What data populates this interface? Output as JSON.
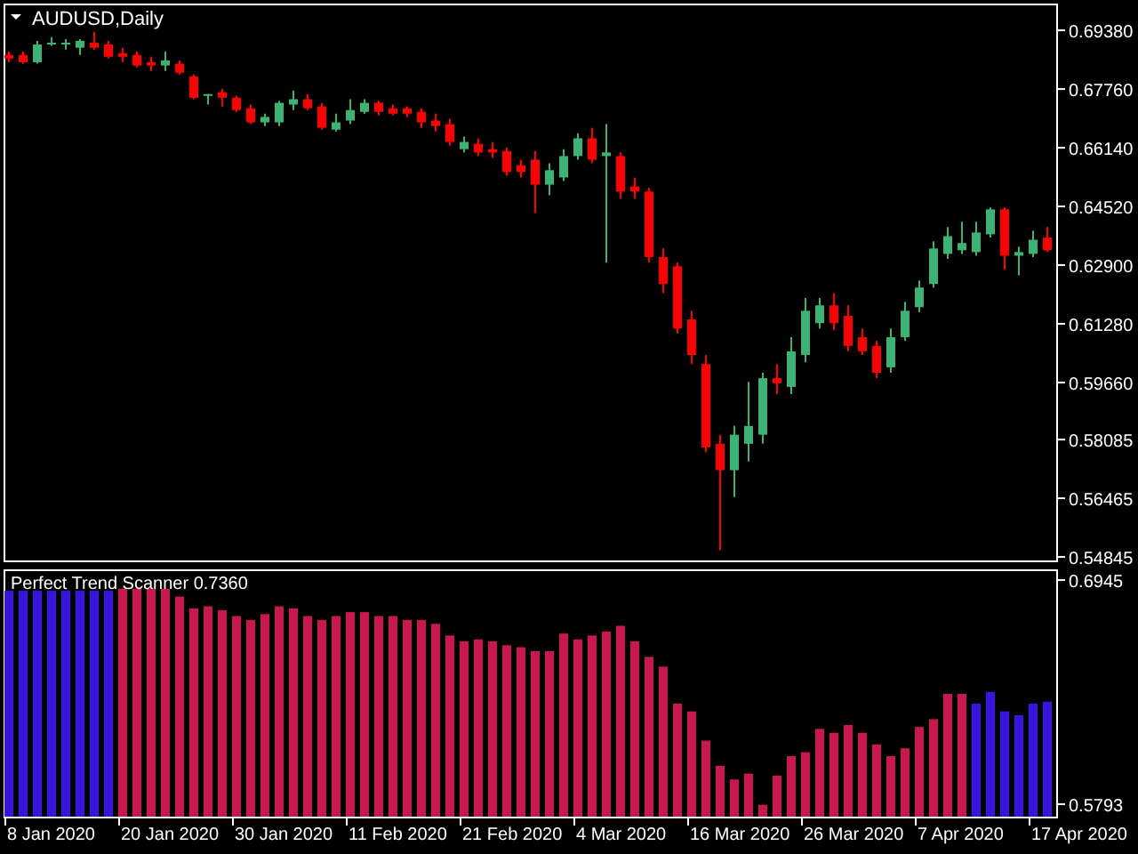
{
  "price_chart": {
    "title": "AUDUSD,Daily",
    "chart_data": {
      "type": "candlestick",
      "ylim": [
        0.547,
        0.7007
      ],
      "yticks": [
        {
          "value": 0.6938,
          "label": "0.69380"
        },
        {
          "value": 0.6776,
          "label": "0.67760"
        },
        {
          "value": 0.6614,
          "label": "0.66140"
        },
        {
          "value": 0.6452,
          "label": "0.64520"
        },
        {
          "value": 0.629,
          "label": "0.62900"
        },
        {
          "value": 0.6128,
          "label": "0.61280"
        },
        {
          "value": 0.5966,
          "label": "0.59660"
        },
        {
          "value": 0.58085,
          "label": "0.58085"
        },
        {
          "value": 0.56465,
          "label": "0.56465"
        },
        {
          "value": 0.54845,
          "label": "0.54845"
        }
      ],
      "categories": [
        null,
        null,
        null,
        null,
        null,
        null,
        null,
        null,
        null,
        null,
        null,
        null,
        null,
        null,
        null,
        null,
        null,
        null,
        null,
        null,
        null,
        null,
        null,
        null,
        null,
        null,
        null,
        null,
        null,
        null,
        null,
        null,
        null,
        null,
        null,
        null,
        null,
        null,
        null,
        null,
        null,
        null,
        null,
        null,
        null,
        null,
        null,
        null,
        null,
        null,
        null,
        null,
        null,
        null,
        null,
        null,
        null,
        null,
        null,
        null,
        null,
        null,
        null,
        null,
        null,
        null,
        null,
        null,
        null,
        null,
        null,
        null,
        null,
        null
      ],
      "ohlc": [
        [
          0.687,
          0.688,
          0.685,
          0.686
        ],
        [
          0.687,
          0.688,
          0.6846,
          0.685
        ],
        [
          0.685,
          0.6909,
          0.6846,
          0.6899
        ],
        [
          0.6899,
          0.6919,
          0.6895,
          0.6904
        ],
        [
          0.6899,
          0.6914,
          0.6885,
          0.6904
        ],
        [
          0.689,
          0.6914,
          0.687,
          0.6909
        ],
        [
          0.6904,
          0.6934,
          0.6885,
          0.689
        ],
        [
          0.6899,
          0.6909,
          0.686,
          0.6865
        ],
        [
          0.6875,
          0.689,
          0.685,
          0.6865
        ],
        [
          0.687,
          0.688,
          0.6836,
          0.6841
        ],
        [
          0.685,
          0.6865,
          0.6826,
          0.6841
        ],
        [
          0.6841,
          0.688,
          0.6826,
          0.6855
        ],
        [
          0.6846,
          0.6855,
          0.6816,
          0.6821
        ],
        [
          0.6811,
          0.6816,
          0.6748,
          0.6752
        ],
        [
          0.6757,
          0.6762,
          0.6733,
          0.6762
        ],
        [
          0.6767,
          0.6777,
          0.6728,
          0.6752
        ],
        [
          0.6752,
          0.6757,
          0.6713,
          0.6718
        ],
        [
          0.6723,
          0.6733,
          0.6679,
          0.6684
        ],
        [
          0.6684,
          0.6708,
          0.6674,
          0.6699
        ],
        [
          0.6684,
          0.6743,
          0.6674,
          0.6738
        ],
        [
          0.6733,
          0.6772,
          0.6718,
          0.6748
        ],
        [
          0.6748,
          0.6762,
          0.6718,
          0.6723
        ],
        [
          0.6728,
          0.6738,
          0.6664,
          0.6669
        ],
        [
          0.6664,
          0.6708,
          0.6659,
          0.6684
        ],
        [
          0.6689,
          0.6748,
          0.6679,
          0.6718
        ],
        [
          0.6713,
          0.6748,
          0.6708,
          0.6738
        ],
        [
          0.6738,
          0.6743,
          0.6703,
          0.6713
        ],
        [
          0.6723,
          0.6733,
          0.6703,
          0.6708
        ],
        [
          0.6723,
          0.6728,
          0.6699,
          0.6708
        ],
        [
          0.6713,
          0.6723,
          0.6669,
          0.6684
        ],
        [
          0.6689,
          0.6708,
          0.6659,
          0.6674
        ],
        [
          0.6679,
          0.6694,
          0.662,
          0.663
        ],
        [
          0.661,
          0.6645,
          0.6601,
          0.663
        ],
        [
          0.6625,
          0.664,
          0.6591,
          0.6601
        ],
        [
          0.661,
          0.663,
          0.6586,
          0.6601
        ],
        [
          0.6605,
          0.6615,
          0.6537,
          0.6547
        ],
        [
          0.6566,
          0.6581,
          0.6532,
          0.6547
        ],
        [
          0.6581,
          0.6605,
          0.6434,
          0.6512
        ],
        [
          0.6512,
          0.6571,
          0.6483,
          0.6552
        ],
        [
          0.6532,
          0.661,
          0.6522,
          0.6591
        ],
        [
          0.6591,
          0.6654,
          0.6581,
          0.664
        ],
        [
          0.664,
          0.6669,
          0.6571,
          0.6581
        ],
        [
          0.6591,
          0.6679,
          0.6297,
          0.6601
        ],
        [
          0.6591,
          0.6601,
          0.6473,
          0.6493
        ],
        [
          0.6507,
          0.6532,
          0.6473,
          0.6493
        ],
        [
          0.6493,
          0.6503,
          0.6297,
          0.6312
        ],
        [
          0.6312,
          0.6336,
          0.6213,
          0.6238
        ],
        [
          0.6287,
          0.6297,
          0.6101,
          0.6115
        ],
        [
          0.614,
          0.6164,
          0.6017,
          0.6042
        ],
        [
          0.6017,
          0.6042,
          0.5773,
          0.5787
        ],
        [
          0.5797,
          0.5822,
          0.5503,
          0.5724
        ],
        [
          0.5724,
          0.5846,
          0.565,
          0.5822
        ],
        [
          0.5797,
          0.5968,
          0.5748,
          0.5846
        ],
        [
          0.5822,
          0.5993,
          0.5797,
          0.5978
        ],
        [
          0.5978,
          0.6017,
          0.5934,
          0.5964
        ],
        [
          0.5954,
          0.6091,
          0.5934,
          0.6052
        ],
        [
          0.6042,
          0.6199,
          0.6022,
          0.6164
        ],
        [
          0.613,
          0.6199,
          0.6115,
          0.6179
        ],
        [
          0.6179,
          0.6213,
          0.611,
          0.613
        ],
        [
          0.615,
          0.6179,
          0.6052,
          0.6067
        ],
        [
          0.6091,
          0.6115,
          0.6042,
          0.6052
        ],
        [
          0.6067,
          0.6081,
          0.5978,
          0.5993
        ],
        [
          0.6008,
          0.6115,
          0.5993,
          0.6091
        ],
        [
          0.6091,
          0.6189,
          0.6081,
          0.6164
        ],
        [
          0.6174,
          0.6248,
          0.616,
          0.6228
        ],
        [
          0.6238,
          0.6356,
          0.6228,
          0.6336
        ],
        [
          0.6321,
          0.6395,
          0.6307,
          0.637
        ],
        [
          0.6331,
          0.641,
          0.6321,
          0.6351
        ],
        [
          0.6326,
          0.641,
          0.6316,
          0.638
        ],
        [
          0.6375,
          0.6449,
          0.6366,
          0.6444
        ],
        [
          0.6444,
          0.6449,
          0.6277,
          0.6316
        ],
        [
          0.6316,
          0.6341,
          0.6262,
          0.6326
        ],
        [
          0.6321,
          0.6385,
          0.6312,
          0.636
        ],
        [
          0.6366,
          0.6395,
          0.6326,
          0.6331
        ]
      ]
    }
  },
  "indicator": {
    "chart_data": {
      "type": "bar",
      "title": "Perfect Trend Scanner 0.7360",
      "ylim": [
        0.5729,
        0.6991
      ],
      "yticks": [
        {
          "value": 0.6945,
          "label": "0.6945"
        },
        {
          "value": 0.5793,
          "label": "0.5793"
        }
      ],
      "categories": [
        null,
        null,
        null,
        null,
        null,
        null,
        null,
        null,
        null,
        null,
        null,
        null,
        null,
        null,
        null,
        null,
        null,
        null,
        null,
        null,
        null,
        null,
        null,
        null,
        null,
        null,
        null,
        null,
        null,
        null,
        null,
        null,
        null,
        null,
        null,
        null,
        null,
        null,
        null,
        null,
        null,
        null,
        null,
        null,
        null,
        null,
        null,
        null,
        null,
        null,
        null,
        null,
        null,
        null,
        null,
        null,
        null,
        null,
        null,
        null,
        null,
        null,
        null,
        null,
        null,
        null,
        null,
        null,
        null,
        null,
        null,
        null,
        null,
        null
      ],
      "series": [
        {
          "color": "#3c14e0",
          "values": [
            0.689,
            0.689,
            0.689,
            0.689,
            0.689,
            0.689,
            0.689,
            0.689,
            null,
            null,
            null,
            null,
            null,
            null,
            null,
            null,
            null,
            null,
            null,
            null,
            null,
            null,
            null,
            null,
            null,
            null,
            null,
            null,
            null,
            null,
            null,
            null,
            null,
            null,
            null,
            null,
            null,
            null,
            null,
            null,
            null,
            null,
            null,
            null,
            null,
            null,
            null,
            null,
            null,
            null,
            null,
            null,
            null,
            null,
            null,
            null,
            null,
            null,
            null,
            null,
            null,
            null,
            null,
            null,
            null,
            null,
            null,
            null,
            0.631,
            0.637,
            0.627,
            0.625,
            0.631,
            0.632
          ]
        },
        {
          "color": "#c8184f",
          "values": [
            null,
            null,
            null,
            null,
            null,
            null,
            null,
            null,
            0.69,
            0.69,
            0.69,
            0.69,
            0.686,
            0.68,
            0.681,
            0.679,
            0.676,
            0.674,
            0.677,
            0.681,
            0.68,
            0.676,
            0.674,
            0.676,
            0.678,
            0.678,
            0.676,
            0.676,
            0.674,
            0.674,
            0.672,
            0.666,
            0.663,
            0.664,
            0.663,
            0.661,
            0.66,
            0.658,
            0.658,
            0.667,
            0.664,
            0.666,
            0.668,
            0.671,
            0.663,
            0.655,
            0.65,
            0.631,
            0.627,
            0.612,
            0.599,
            0.592,
            0.595,
            0.579,
            0.594,
            0.604,
            0.606,
            0.618,
            0.616,
            0.62,
            0.616,
            0.61,
            0.604,
            0.608,
            0.619,
            0.623,
            0.636,
            0.636,
            null,
            null,
            null,
            null,
            null,
            null
          ]
        }
      ]
    }
  },
  "time_axis": {
    "labels": [
      "8 Jan 2020",
      "20 Jan 2020",
      "30 Jan 2020",
      "11 Feb 2020",
      "21 Feb 2020",
      "4 Mar 2020",
      "16 Mar 2020",
      "26 Mar 2020",
      "7 Apr 2020",
      "17 Apr 2020"
    ]
  }
}
